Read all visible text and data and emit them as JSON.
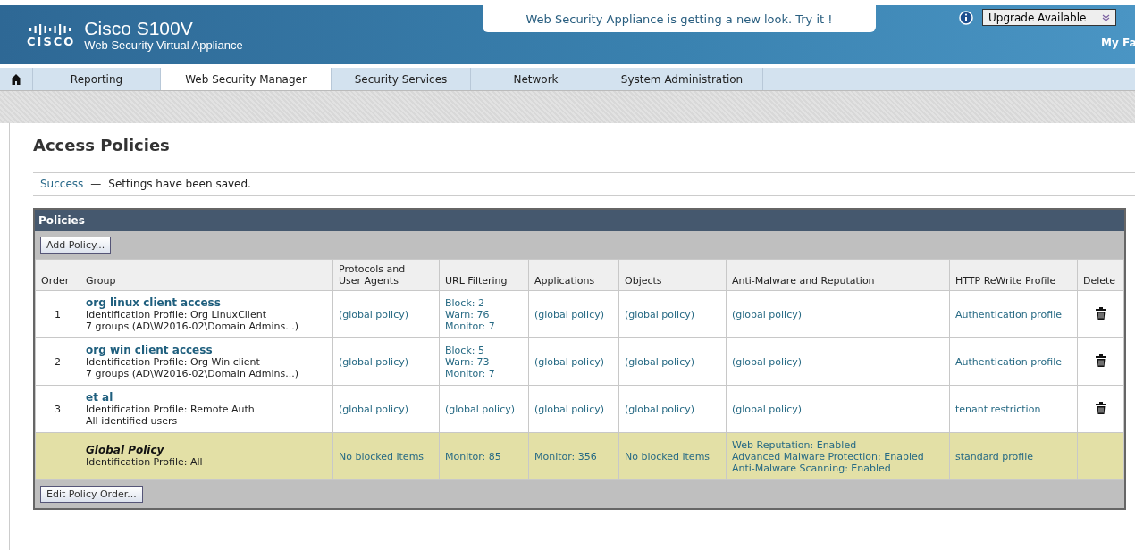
{
  "header": {
    "logo": "CISCO",
    "product": "Cisco S100V",
    "subtitle": "Web Security Virtual Appliance",
    "banner": "Web Security Appliance is getting a new look. Try it !",
    "upgrade": "Upgrade Available",
    "favorites": "My Fa"
  },
  "nav": [
    {
      "label": "Reporting",
      "selected": false
    },
    {
      "label": "Web Security Manager",
      "selected": true
    },
    {
      "label": "Security Services",
      "selected": false
    },
    {
      "label": "Network",
      "selected": false
    },
    {
      "label": "System Administration",
      "selected": false
    }
  ],
  "page_title": "Access Policies",
  "notice": {
    "status": "Success",
    "separator": "—",
    "message": "Settings have been saved."
  },
  "policies": {
    "title": "Policies",
    "add_button": "Add Policy...",
    "order_button": "Edit Policy Order...",
    "columns": [
      "Order",
      "Group",
      "Protocols and User Agents",
      "URL Filtering",
      "Applications",
      "Objects",
      "Anti-Malware and Reputation",
      "HTTP ReWrite Profile",
      "Delete"
    ],
    "rows": [
      {
        "kind": "policy",
        "cells": [
          "1",
          [
            "org linux client access",
            "Identification Profile: Org LinuxClient",
            "7 groups (AD\\W2016-02\\Domain Admins...)"
          ],
          [
            "(global policy)"
          ],
          [
            "Block: 2",
            "Warn: 76",
            "Monitor: 7"
          ],
          [
            "(global policy)"
          ],
          [
            "(global policy)"
          ],
          [
            "(global policy)"
          ],
          [
            "Authentication profile"
          ]
        ],
        "deletable": true
      },
      {
        "kind": "policy",
        "cells": [
          "2",
          [
            "org win client access",
            "Identification Profile: Org Win client",
            "7 groups (AD\\W2016-02\\Domain Admins...)"
          ],
          [
            "(global policy)"
          ],
          [
            "Block: 5",
            "Warn: 73",
            "Monitor: 7"
          ],
          [
            "(global policy)"
          ],
          [
            "(global policy)"
          ],
          [
            "(global policy)"
          ],
          [
            "Authentication profile"
          ]
        ],
        "deletable": true
      },
      {
        "kind": "policy",
        "cells": [
          "3",
          [
            "et al",
            "Identification Profile: Remote Auth",
            "All identified users"
          ],
          [
            "(global policy)"
          ],
          [
            "(global policy)"
          ],
          [
            "(global policy)"
          ],
          [
            "(global policy)"
          ],
          [
            "(global policy)"
          ],
          [
            "tenant restriction"
          ]
        ],
        "deletable": true
      },
      {
        "kind": "global",
        "cells": [
          "",
          [
            "Global Policy",
            "Identification Profile: All"
          ],
          [
            "No blocked items"
          ],
          [
            "Monitor: 85"
          ],
          [
            "Monitor: 356"
          ],
          [
            "No blocked items"
          ],
          [
            "Web Reputation: Enabled",
            "Advanced Malware Protection: Enabled",
            "Anti-Malware Scanning: Enabled"
          ],
          [
            "standard profile"
          ]
        ],
        "deletable": false
      }
    ]
  }
}
